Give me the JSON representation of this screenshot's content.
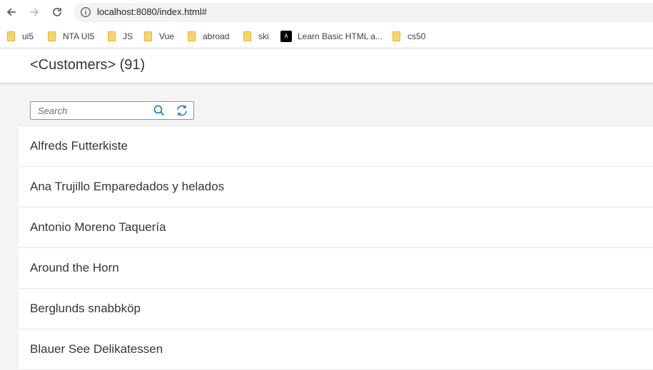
{
  "browser": {
    "url": "localhost:8080/index.html#",
    "bookmarks": [
      {
        "label": "ui5",
        "icon": "folder-icon"
      },
      {
        "label": "NTA UI5",
        "icon": "folder-icon"
      },
      {
        "label": "JS",
        "icon": "folder-icon"
      },
      {
        "label": "Vue",
        "icon": "folder-icon"
      },
      {
        "label": "abroad",
        "icon": "folder-icon"
      },
      {
        "label": "ski",
        "icon": "folder-icon"
      },
      {
        "label": "Learn Basic HTML a...",
        "icon": "codeacademy-icon"
      },
      {
        "label": "cs50",
        "icon": "folder-icon"
      }
    ]
  },
  "app": {
    "title": "<Customers> (91)",
    "search": {
      "placeholder": "Search",
      "value": ""
    },
    "customers": [
      "Alfreds Futterkiste",
      "Ana Trujillo Emparedados y helados",
      "Antonio Moreno Taquería",
      "Around the Horn",
      "Berglunds snabbköp",
      "Blauer See Delikatessen"
    ]
  },
  "colors": {
    "accent": "#0a6ed1",
    "text": "#32363a",
    "background": "#f4f4f4"
  }
}
